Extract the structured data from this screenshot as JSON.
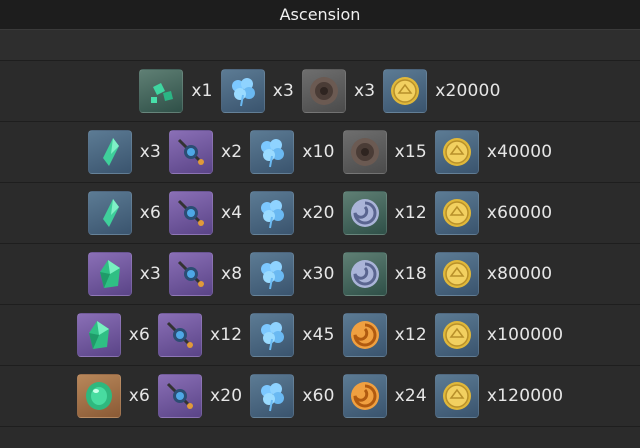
{
  "header": {
    "title": "Ascension"
  },
  "rows": [
    {
      "items": [
        {
          "icon": "gem-fragment-icon",
          "rarity": "green",
          "qty": "x1"
        },
        {
          "icon": "blue-flower-icon",
          "rarity": "blue",
          "qty": "x3"
        },
        {
          "icon": "brown-disc-icon",
          "rarity": "gray",
          "qty": "x3"
        },
        {
          "icon": "gold-coin-icon",
          "rarity": "blue",
          "qty": "x20000"
        }
      ]
    },
    {
      "items": [
        {
          "icon": "gem-sliver-icon",
          "rarity": "blue",
          "qty": "x3"
        },
        {
          "icon": "orb-device-icon",
          "rarity": "purple",
          "qty": "x2"
        },
        {
          "icon": "blue-flower-icon",
          "rarity": "blue",
          "qty": "x10"
        },
        {
          "icon": "brown-disc-icon",
          "rarity": "gray",
          "qty": "x15"
        },
        {
          "icon": "gold-coin-icon",
          "rarity": "blue",
          "qty": "x40000"
        }
      ]
    },
    {
      "items": [
        {
          "icon": "gem-sliver-icon",
          "rarity": "blue",
          "qty": "x6"
        },
        {
          "icon": "orb-device-icon",
          "rarity": "purple",
          "qty": "x4"
        },
        {
          "icon": "blue-flower-icon",
          "rarity": "blue",
          "qty": "x20"
        },
        {
          "icon": "silver-swirl-icon",
          "rarity": "green",
          "qty": "x12"
        },
        {
          "icon": "gold-coin-icon",
          "rarity": "blue",
          "qty": "x60000"
        }
      ]
    },
    {
      "items": [
        {
          "icon": "gem-chunk-icon",
          "rarity": "purple",
          "qty": "x3"
        },
        {
          "icon": "orb-device-icon",
          "rarity": "purple",
          "qty": "x8"
        },
        {
          "icon": "blue-flower-icon",
          "rarity": "blue",
          "qty": "x30"
        },
        {
          "icon": "silver-swirl-icon",
          "rarity": "green",
          "qty": "x18"
        },
        {
          "icon": "gold-coin-icon",
          "rarity": "blue",
          "qty": "x80000"
        }
      ]
    },
    {
      "items": [
        {
          "icon": "gem-chunk-icon",
          "rarity": "purple",
          "qty": "x6"
        },
        {
          "icon": "orb-device-icon",
          "rarity": "purple",
          "qty": "x12"
        },
        {
          "icon": "blue-flower-icon",
          "rarity": "blue",
          "qty": "x45"
        },
        {
          "icon": "orange-swirl-icon",
          "rarity": "blue",
          "qty": "x12"
        },
        {
          "icon": "gold-coin-icon",
          "rarity": "blue",
          "qty": "x100000"
        }
      ]
    },
    {
      "items": [
        {
          "icon": "gem-gemstone-icon",
          "rarity": "gold",
          "qty": "x6"
        },
        {
          "icon": "orb-device-icon",
          "rarity": "purple",
          "qty": "x20"
        },
        {
          "icon": "blue-flower-icon",
          "rarity": "blue",
          "qty": "x60"
        },
        {
          "icon": "orange-swirl-icon",
          "rarity": "blue",
          "qty": "x24"
        },
        {
          "icon": "gold-coin-icon",
          "rarity": "blue",
          "qty": "x120000"
        }
      ]
    }
  ]
}
